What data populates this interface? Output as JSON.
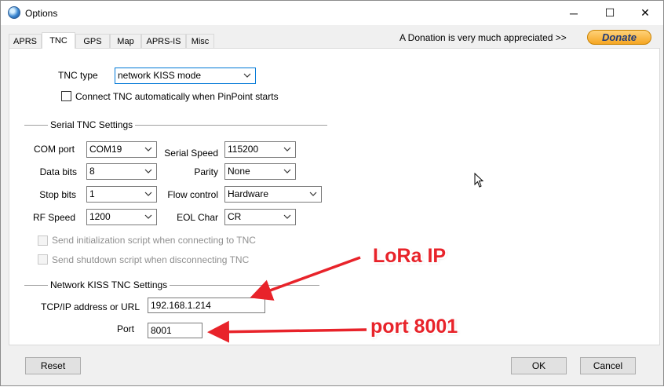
{
  "window": {
    "title": "Options",
    "minimize_glyph": "─",
    "maximize_glyph": "☐",
    "close_glyph": "✕"
  },
  "tabs": [
    {
      "label": "APRS"
    },
    {
      "label": "TNC"
    },
    {
      "label": "GPS"
    },
    {
      "label": "Map"
    },
    {
      "label": "APRS-IS"
    },
    {
      "label": "Misc"
    }
  ],
  "active_tab": "TNC",
  "donation": {
    "text": "A Donation is very much appreciated >>",
    "button_label": "Donate"
  },
  "tnc": {
    "type_label": "TNC type",
    "type_value": "network KISS mode",
    "auto_connect_label": "Connect TNC automatically when PinPoint starts"
  },
  "serial": {
    "group_title": "Serial TNC Settings",
    "com_port_label": "COM port",
    "com_port_value": "COM19",
    "serial_speed_label": "Serial Speed",
    "serial_speed_value": "115200",
    "data_bits_label": "Data bits",
    "data_bits_value": "8",
    "parity_label": "Parity",
    "parity_value": "None",
    "stop_bits_label": "Stop bits",
    "stop_bits_value": "1",
    "flow_control_label": "Flow control",
    "flow_control_value": "Hardware",
    "rf_speed_label": "RF Speed",
    "rf_speed_value": "1200",
    "eol_char_label": "EOL Char",
    "eol_char_value": "CR",
    "init_script_label": "Send initialization script when connecting to TNC",
    "shutdown_script_label": "Send shutdown script when disconnecting TNC"
  },
  "network": {
    "group_title": "Network KISS TNC Settings",
    "address_label": "TCP/IP address or URL",
    "address_value": "192.168.1.214",
    "port_label": "Port",
    "port_value": "8001"
  },
  "annotations": {
    "lora_ip": "LoRa IP",
    "port": "port 8001",
    "color": "#e8232a"
  },
  "buttons": {
    "reset": "Reset",
    "ok": "OK",
    "cancel": "Cancel"
  }
}
